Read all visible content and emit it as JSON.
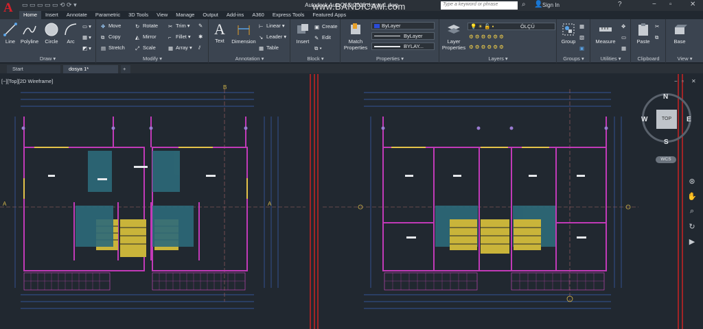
{
  "app": {
    "title": "Autodesk AutoCAD 2018   dosya 1.dwg",
    "watermark": "www.BANDICAM.com",
    "search_placeholder": "Type a keyword or phrase",
    "sign_in": "Sign In"
  },
  "tabs": [
    "Home",
    "Insert",
    "Annotate",
    "Parametric",
    "3D Tools",
    "View",
    "Manage",
    "Output",
    "Add-ins",
    "A360",
    "Express Tools",
    "Featured Apps"
  ],
  "ribbon": {
    "draw": {
      "title": "Draw ▾",
      "line": "Line",
      "polyline": "Polyline",
      "circle": "Circle",
      "arc": "Arc"
    },
    "modify": {
      "title": "Modify ▾",
      "move": "Move",
      "rotate": "Rotate",
      "trim": "Trim ▾",
      "copy": "Copy",
      "mirror": "Mirror",
      "fillet": "Fillet ▾",
      "stretch": "Stretch",
      "scale": "Scale",
      "array": "Array ▾"
    },
    "annotation": {
      "title": "Annotation ▾",
      "text": "Text",
      "dimension": "Dimension",
      "linear": "Linear ▾",
      "leader": "Leader ▾",
      "table": "Table"
    },
    "block": {
      "title": "Block ▾",
      "insert": "Insert",
      "create": "Create",
      "edit": "Edit"
    },
    "properties": {
      "title": "Properties ▾",
      "match": "Match\nProperties",
      "color": "ByLayer",
      "linetype": "ByLayer",
      "lineweight": "BYLAY..."
    },
    "layers": {
      "title": "Layers ▾",
      "layer_props": "Layer\nProperties",
      "current_layer": "ÖLÇÜ"
    },
    "groups": {
      "title": "Groups ▾",
      "group": "Group"
    },
    "utilities": {
      "title": "Utilities ▾",
      "measure": "Measure"
    },
    "clipboard": {
      "title": "Clipboard",
      "paste": "Paste"
    },
    "view": {
      "title": "View ▾",
      "base": "Base"
    }
  },
  "doc_tabs": {
    "start": "Start",
    "file": "dosya 1*",
    "add": "+"
  },
  "viewport": {
    "label": "[−][Top][2D Wireframe]",
    "viewcube": {
      "n": "N",
      "s": "S",
      "e": "E",
      "w": "W",
      "top": "TOP",
      "wcs": "WCS"
    }
  },
  "drawing": {
    "section_a": "A",
    "section_b": "B"
  }
}
